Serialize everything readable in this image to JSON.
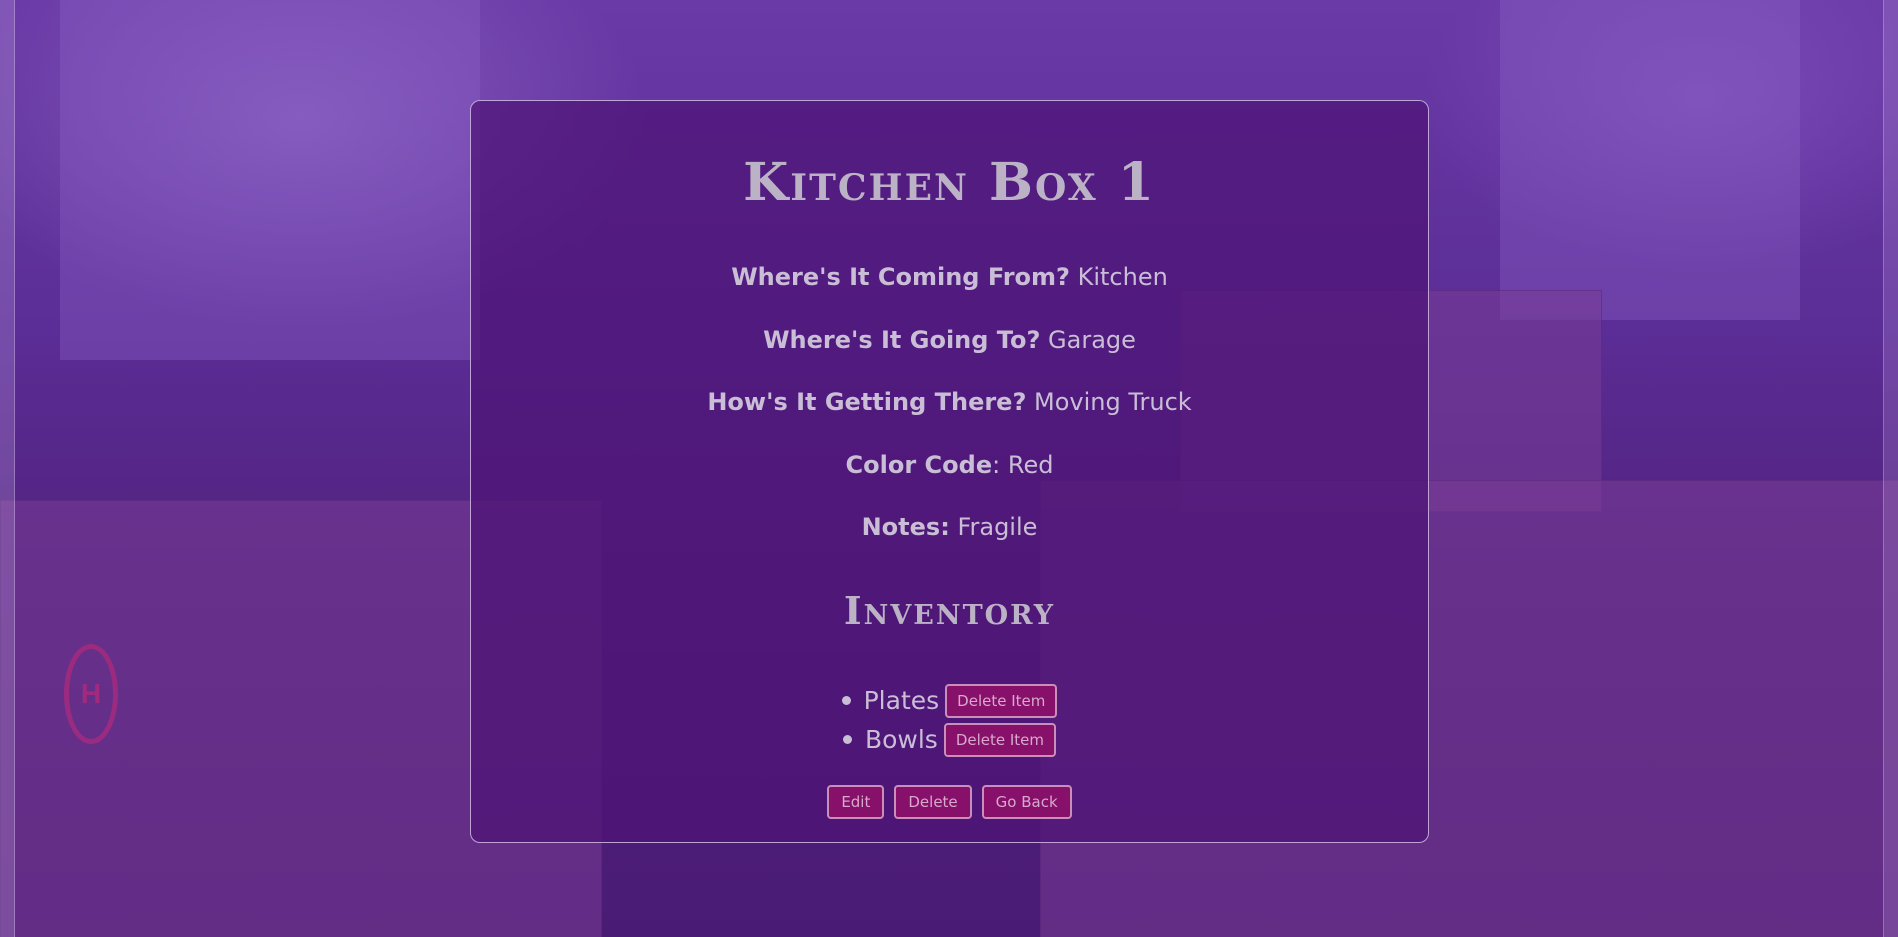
{
  "box": {
    "title": "Kitchen Box 1",
    "fields": [
      {
        "label": "Where's It Coming From?",
        "value": "Kitchen"
      },
      {
        "label": "Where's It Going To?",
        "value": "Garage"
      },
      {
        "label": "How's It Getting There?",
        "value": "Moving Truck"
      },
      {
        "label": "Color Code",
        "suffix": ":",
        "value": "Red"
      },
      {
        "label": "Notes:",
        "value": "Fragile"
      }
    ]
  },
  "inventory": {
    "heading": "Inventory",
    "items": [
      {
        "name": "Plates",
        "delete_label": "Delete Item"
      },
      {
        "name": "Bowls",
        "delete_label": "Delete Item"
      }
    ]
  },
  "actions": {
    "edit_label": "Edit",
    "delete_label": "Delete",
    "back_label": "Go Back"
  },
  "background": {
    "logo_letter": "H"
  },
  "colors": {
    "button_bg": "#86106a",
    "button_border": "#c98fb8",
    "card_border": "#dcc8f0",
    "text": "#c9bed6"
  }
}
